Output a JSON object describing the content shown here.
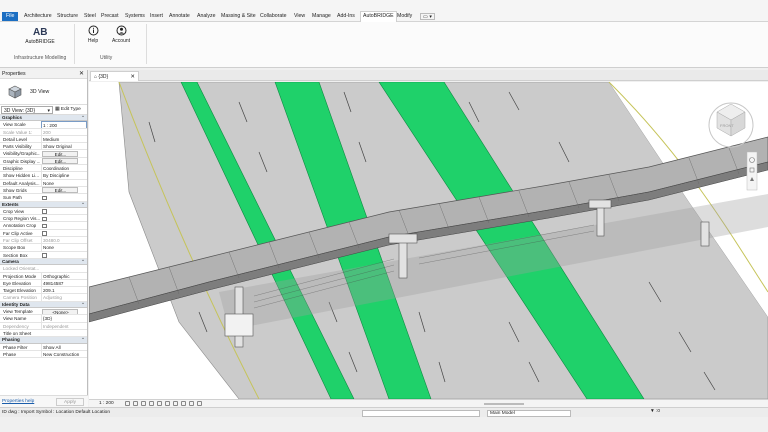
{
  "ribbon_tabs": [
    "File",
    "Architecture",
    "Structure",
    "Steel",
    "Precast",
    "Systems",
    "Insert",
    "Annotate",
    "Analyze",
    "Massing & Site",
    "Collaborate",
    "View",
    "Manage",
    "Add-Ins",
    "AutoBRIDGE",
    "Modify"
  ],
  "active_tab": "AutoBRIDGE",
  "ribbon": {
    "autobridge_label": "AutoBRIDGE",
    "panel1_label": "Infrastructure Modelling",
    "help_label": "Help",
    "account_label": "Account",
    "panel2_label": "Utility"
  },
  "properties": {
    "title": "Properties",
    "type_name": "3D View",
    "view_selector": "3D View: {3D}",
    "edit_type": "Edit Type",
    "sections": [
      {
        "name": "Graphics",
        "rows": [
          {
            "k": "View Scale",
            "v": "1 : 200",
            "kind": "input"
          },
          {
            "k": "Scale Value    1:",
            "v": "200",
            "kind": "dim"
          },
          {
            "k": "Detail Level",
            "v": "Medium"
          },
          {
            "k": "Parts Visibility",
            "v": "Show Original"
          },
          {
            "k": "Visibility/Graphic...",
            "v": "Edit...",
            "kind": "btn"
          },
          {
            "k": "Graphic Display ...",
            "v": "Edit...",
            "kind": "btn"
          },
          {
            "k": "Discipline",
            "v": "Coordination"
          },
          {
            "k": "Show Hidden Li...",
            "v": "By Discipline"
          },
          {
            "k": "Default Analysis...",
            "v": "None"
          },
          {
            "k": "Show Grids",
            "v": "Edit...",
            "kind": "btn"
          },
          {
            "k": "Sun Path",
            "v": "",
            "kind": "chk"
          }
        ]
      },
      {
        "name": "Extents",
        "rows": [
          {
            "k": "Crop View",
            "v": "",
            "kind": "chk"
          },
          {
            "k": "Crop Region Vis...",
            "v": "",
            "kind": "chk"
          },
          {
            "k": "Annotation Crop",
            "v": "",
            "kind": "chk"
          },
          {
            "k": "Far Clip Active",
            "v": "",
            "kind": "chk"
          },
          {
            "k": "Far Clip Offset",
            "v": "30480.0",
            "kind": "dim"
          },
          {
            "k": "Scope Box",
            "v": "None"
          },
          {
            "k": "Section Box",
            "v": "",
            "kind": "chk"
          }
        ]
      },
      {
        "name": "Camera",
        "rows": [
          {
            "k": "Locked Orientat...",
            "v": "",
            "kind": "dimk"
          },
          {
            "k": "Projection Mode",
            "v": "Orthographic"
          },
          {
            "k": "Eye Elevation",
            "v": "49814587"
          },
          {
            "k": "Target Elevation",
            "v": "209.1"
          },
          {
            "k": "Camera Position",
            "v": "Adjusting",
            "kind": "dim"
          }
        ]
      },
      {
        "name": "Identity Data",
        "rows": [
          {
            "k": "View Template",
            "v": "<None>",
            "kind": "btn"
          },
          {
            "k": "View Name",
            "v": "{3D}"
          },
          {
            "k": "Dependency",
            "v": "Independent",
            "kind": "dim"
          },
          {
            "k": "Title on Sheet",
            "v": ""
          }
        ]
      },
      {
        "name": "Phasing",
        "rows": [
          {
            "k": "Phase Filter",
            "v": "Show All"
          },
          {
            "k": "Phase",
            "v": "New Construction"
          }
        ]
      }
    ],
    "help_link": "Properties help",
    "apply": "Apply"
  },
  "view": {
    "tab_label": "{3D}",
    "scale": "1 : 200",
    "viewcube_face": "FRONT"
  },
  "status": {
    "message": "ID dwg : Import Symbol : Location Default Location",
    "model_label": "Main Model",
    "filter_count": ":0"
  },
  "colors": {
    "accent": "#1b6ec2",
    "median_green": "#1fd16a",
    "road_grey": "#c9c9c9",
    "bridge_grey": "#9a9a9a"
  }
}
